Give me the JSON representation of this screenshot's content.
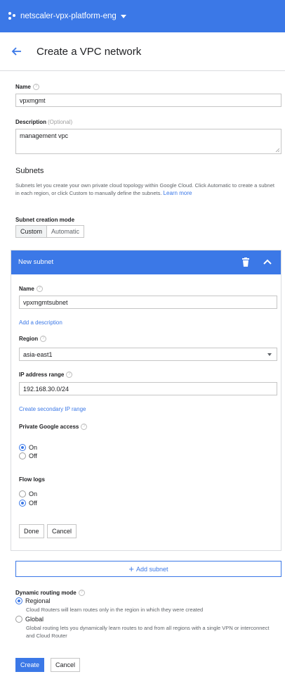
{
  "topbar": {
    "project": "netscaler-vpx-platform-eng",
    "bg": "#3b78e7"
  },
  "header": {
    "title": "Create a VPC network"
  },
  "form": {
    "name_label": "Name",
    "name_value": "vpxmgmt",
    "desc_label": "Description",
    "desc_optional": "(Optional)",
    "desc_value": "management vpc"
  },
  "subnets": {
    "heading": "Subnets",
    "description": "Subnets let you create your own private cloud topology within Google Cloud. Click Automatic to create a subnet in each region, or click Custom to manually define the subnets.",
    "learn_more": "Learn more",
    "mode_label": "Subnet creation mode",
    "mode_options": [
      "Custom",
      "Automatic"
    ]
  },
  "new_subnet": {
    "title": "New subnet",
    "name_label": "Name",
    "name_value": "vpxmgmtsubnet",
    "add_description": "Add a description",
    "region_label": "Region",
    "region_value": "asia-east1",
    "ip_label": "IP address range",
    "ip_value": "192.168.30.0/24",
    "secondary_range": "Create secondary IP range",
    "private_access_label": "Private Google access",
    "private_access_on": "On",
    "private_access_off": "Off",
    "private_access_selected": "On",
    "flow_logs_label": "Flow logs",
    "flow_on": "On",
    "flow_off": "Off",
    "flow_selected": "Off",
    "done": "Done",
    "cancel": "Cancel"
  },
  "add_subnet": "Add subnet",
  "routing": {
    "label": "Dynamic routing mode",
    "regional": "Regional",
    "regional_desc": "Cloud Routers will learn routes only in the region in which they were created",
    "global": "Global",
    "global_desc": "Global routing lets you dynamically learn routes to and from all regions with a single VPN or interconnect and Cloud Router",
    "selected": "Regional"
  },
  "actions": {
    "create": "Create",
    "cancel": "Cancel"
  }
}
